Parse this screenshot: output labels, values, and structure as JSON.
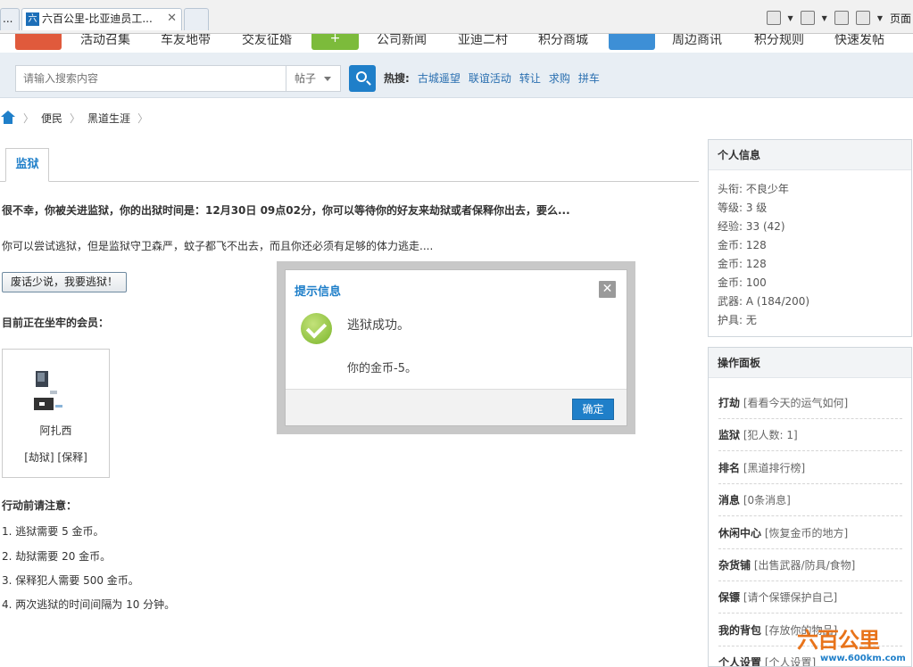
{
  "browser": {
    "tabs": [
      {
        "label": "..."
      },
      {
        "label": "六百公里-比亚迪员工...",
        "favicon": "六",
        "close": "✕"
      },
      {
        "label": ""
      }
    ],
    "toolbar": {
      "page_label": "页面"
    }
  },
  "nav": {
    "items": [
      "活动召集",
      "车友地带",
      "交友征婚",
      "公司新闻",
      "亚迪二村",
      "积分商城",
      "周边商讯",
      "积分规则",
      "快速发帖"
    ],
    "badges": [
      {
        "color": "#e05a3c"
      },
      {
        "color": "#7cbb3b",
        "glyph": "+"
      },
      {
        "color": "#3d8fd6"
      }
    ]
  },
  "search": {
    "placeholder": "请输入搜索内容",
    "type": "帖子",
    "hot_label": "热搜:",
    "hot_links": [
      "古城遥望",
      "联谊活动",
      "转让",
      "求购",
      "拼车"
    ]
  },
  "breadcrumb": {
    "items": [
      "便民",
      "黑道生涯"
    ]
  },
  "main": {
    "tab": "监狱",
    "line1": "很不幸，你被关进监狱，你的出狱时间是：12月30日 09点02分，你可以等待你的好友来劫狱或者保释你出去，要么...",
    "line2": "你可以尝试逃狱，但是监狱守卫森严，蚊子都飞不出去，而且你还必须有足够的体力逃走....",
    "escape_button": "废话少说，我要逃狱！",
    "members_title": "目前正在坐牢的会员：",
    "member": {
      "name": "阿扎西",
      "actions": "[劫狱] [保释]"
    },
    "notes_title": "行动前请注意：",
    "notes": [
      "1. 逃狱需要 5 金币。",
      "2. 劫狱需要 20 金币。",
      "3. 保释犯人需要 500 金币。",
      "4. 两次逃狱的时间间隔为 10 分钟。"
    ]
  },
  "info_panel": {
    "title": "个人信息",
    "rows": [
      "头衔: 不良少年",
      "等级: 3 级",
      "经验: 33 (42)",
      "金币: 128",
      "金币: 128",
      "金币: 100",
      "武器: A (184/200)",
      "护具: 无"
    ]
  },
  "ops_panel": {
    "title": "操作面板",
    "rows": [
      {
        "name": "打劫",
        "desc": "[看看今天的运气如何]"
      },
      {
        "name": "监狱",
        "desc": "[犯人数: 1]"
      },
      {
        "name": "排名",
        "desc": "[黑道排行榜]"
      },
      {
        "name": "消息",
        "desc": "[0条消息]"
      },
      {
        "name": "休闲中心",
        "desc": "[恢复金币的地方]"
      },
      {
        "name": "杂货铺",
        "desc": "[出售武器/防具/食物]"
      },
      {
        "name": "保镖",
        "desc": "[请个保镖保护自己]"
      },
      {
        "name": "我的背包",
        "desc": "[存放你的物品]"
      },
      {
        "name": "个人设置",
        "desc": "[个人设置]"
      }
    ]
  },
  "modal": {
    "title": "提示信息",
    "close": "✕",
    "message": "逃狱成功。",
    "detail": "你的金币-5。",
    "ok": "确定"
  },
  "watermark": {
    "logo": "六百公里",
    "url": "www.600km.com"
  }
}
